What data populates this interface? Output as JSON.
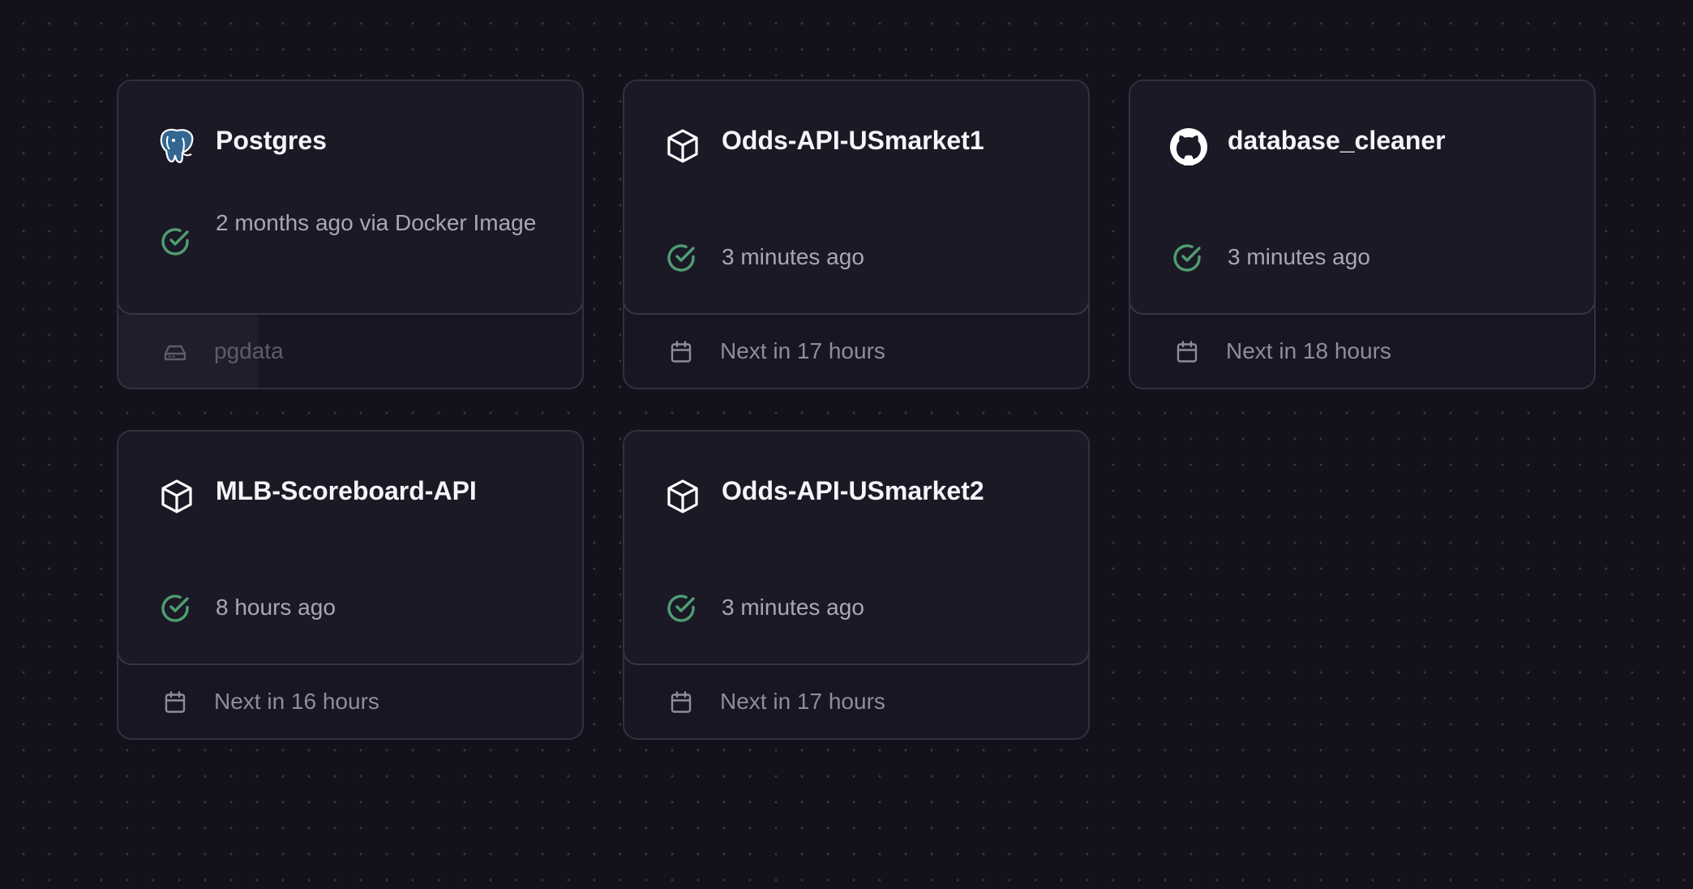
{
  "colors": {
    "background": "#13111c",
    "card": "#1b1926",
    "status_success": "#4f9e72",
    "text_primary": "#f5f4f8",
    "text_secondary": "#a9a6b6"
  },
  "services": [
    {
      "name": "Postgres",
      "icon": "postgres-elephant-icon",
      "status_icon": "check-circle-icon",
      "status_text": "2 months ago via Docker Image",
      "footer_icon": "hard-drive-icon",
      "footer_text": "pgdata"
    },
    {
      "name": "Odds-API-USmarket1",
      "icon": "cube-icon",
      "status_icon": "check-circle-icon",
      "status_text": "3 minutes ago",
      "footer_icon": "calendar-icon",
      "footer_text": "Next in 17 hours"
    },
    {
      "name": "database_cleaner",
      "icon": "github-icon",
      "status_icon": "check-circle-icon",
      "status_text": "3 minutes ago",
      "footer_icon": "calendar-icon",
      "footer_text": "Next in 18 hours"
    },
    {
      "name": "MLB-Scoreboard-API",
      "icon": "cube-icon",
      "status_icon": "check-circle-icon",
      "status_text": "8 hours ago",
      "footer_icon": "calendar-icon",
      "footer_text": "Next in 16 hours"
    },
    {
      "name": "Odds-API-USmarket2",
      "icon": "cube-icon",
      "status_icon": "check-circle-icon",
      "status_text": "3 minutes ago",
      "footer_icon": "calendar-icon",
      "footer_text": "Next in 17 hours"
    }
  ]
}
